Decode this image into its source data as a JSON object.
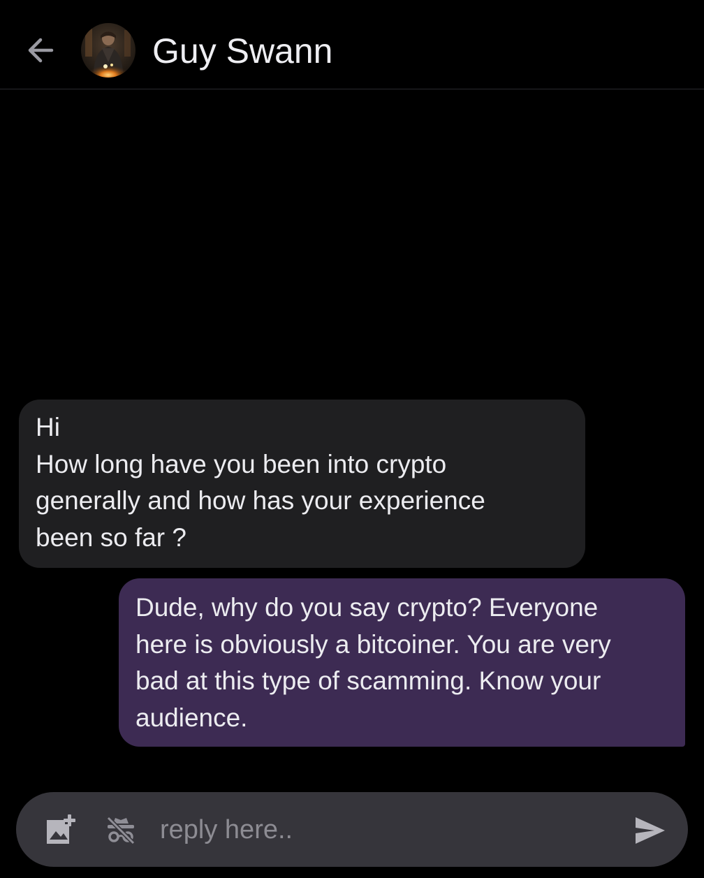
{
  "header": {
    "title": "Guy Swann",
    "back_icon": "arrow-left-icon",
    "avatar_icon": "contact-avatar"
  },
  "messages": [
    {
      "direction": "incoming",
      "lines": [
        "Hi",
        "How long have you been into crypto",
        "generally and how has your experience",
        "been so far ?"
      ]
    },
    {
      "direction": "outgoing",
      "lines": [
        "Dude, why do you say crypto? Everyone",
        "here is obviously a bitcoiner. You are very",
        "bad at this type of scamming. Know your",
        "audience."
      ]
    }
  ],
  "composer": {
    "placeholder": "reply here..",
    "attach_icon": "add-image-icon",
    "anon_icon": "incognito-off-icon",
    "send_icon": "send-icon"
  },
  "colors": {
    "background": "#000000",
    "incoming_bubble": "#1f1f21",
    "outgoing_bubble": "#3d2b53",
    "composer": "#36353b"
  }
}
